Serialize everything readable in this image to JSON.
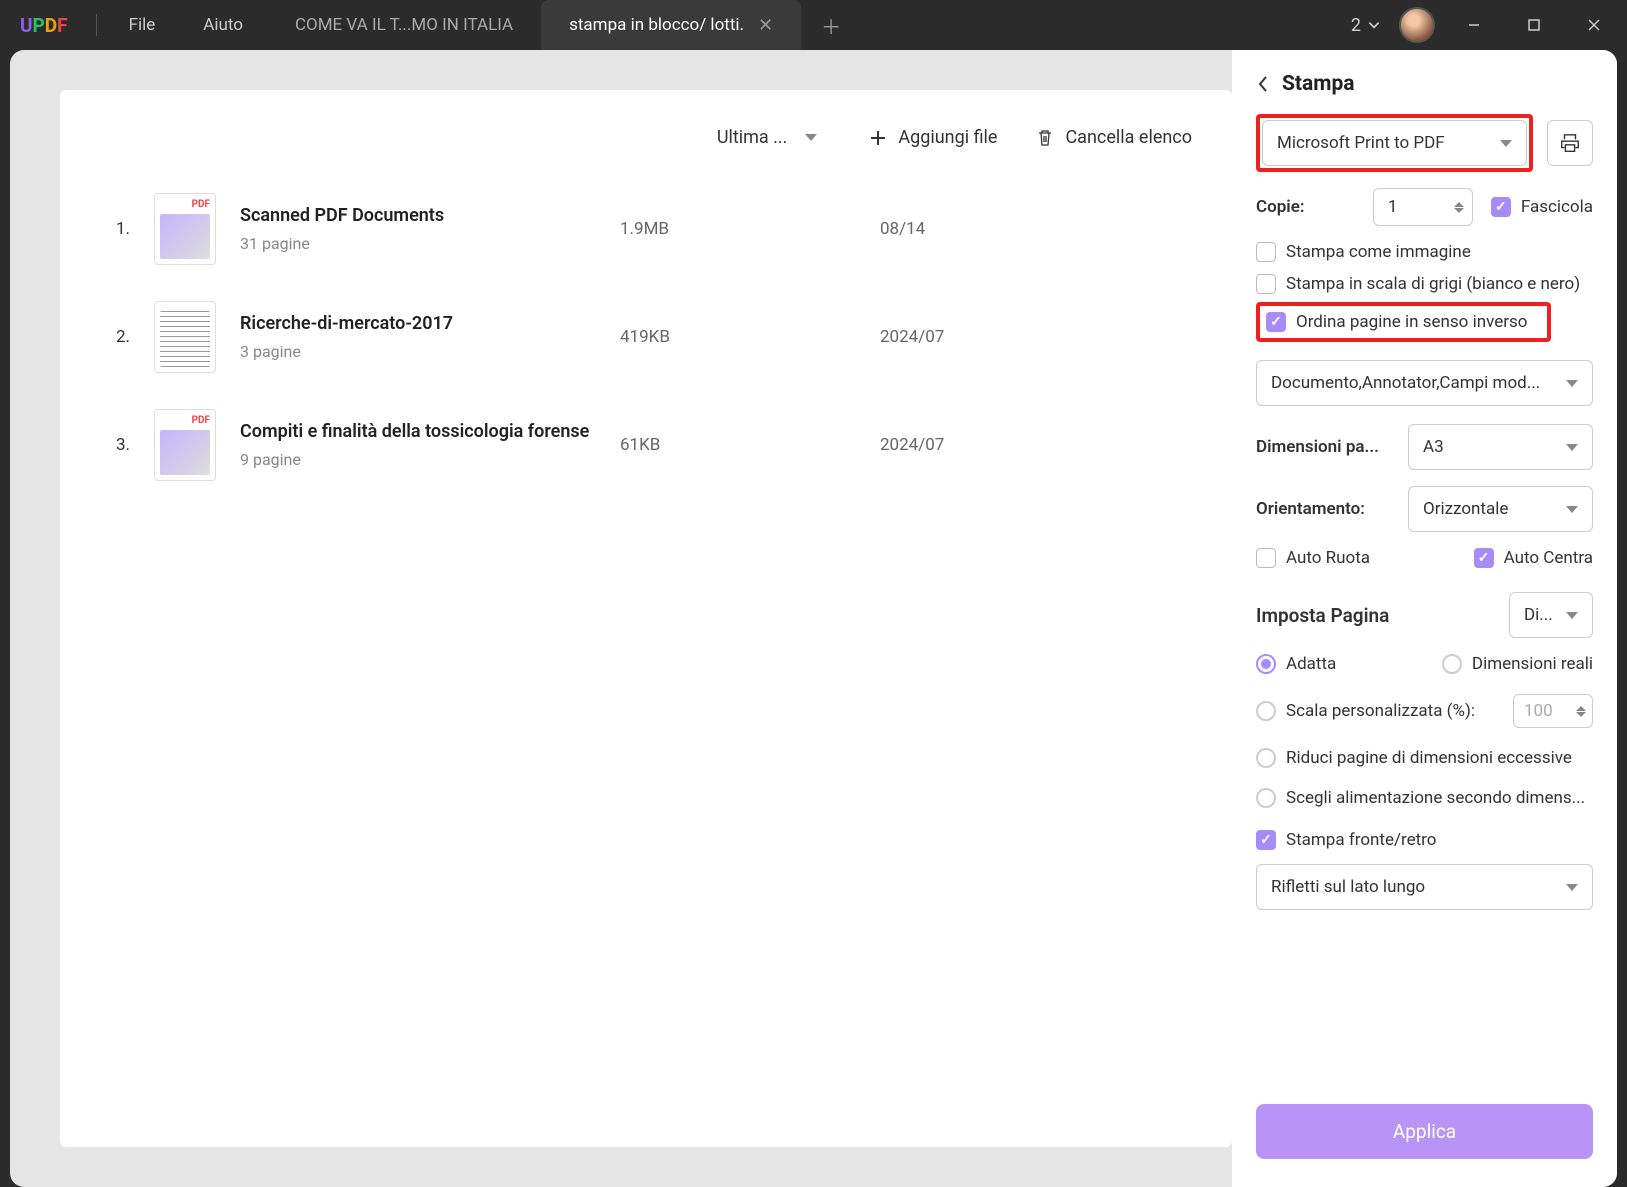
{
  "titlebar": {
    "menu_file": "File",
    "menu_help": "Aiuto",
    "tab_inactive": "COME VA IL T...MO IN ITALIA",
    "tab_active": "stampa in blocco/ lotti.",
    "counter": "2"
  },
  "toolbar": {
    "sort": "Ultima ...",
    "add_file": "Aggiungi file",
    "clear": "Cancella elenco"
  },
  "files": [
    {
      "idx": "1.",
      "name": "Scanned PDF Documents",
      "pages": "31 pagine",
      "size": "1.9MB",
      "date": "08/14",
      "thumb": "pdf"
    },
    {
      "idx": "2.",
      "name": "Ricerche-di-mercato-2017",
      "pages": "3 pagine",
      "size": "419KB",
      "date": "2024/07",
      "thumb": "doc"
    },
    {
      "idx": "3.",
      "name": "Compiti e finalità della tossicologia forense",
      "pages": "9 pagine",
      "size": "61KB",
      "date": "2024/07",
      "thumb": "pdf"
    }
  ],
  "panel": {
    "title": "Stampa",
    "printer": "Microsoft Print to PDF",
    "copies_label": "Copie:",
    "copies_value": "1",
    "collate": "Fascicola",
    "print_as_image": "Stampa come immagine",
    "grayscale": "Stampa in scala di grigi (bianco e nero)",
    "reverse": "Ordina pagine in senso inverso",
    "content_dd": "Documento,Annotator,Campi mod...",
    "paper_label": "Dimensioni pa...",
    "paper_value": "A3",
    "orient_label": "Orientamento:",
    "orient_value": "Orizzontale",
    "auto_rotate": "Auto Ruota",
    "auto_center": "Auto Centra",
    "page_setup": "Imposta Pagina",
    "page_setup_dd": "Di...",
    "radio_fit": "Adatta",
    "radio_actual": "Dimensioni reali",
    "radio_scale": "Scala personalizzata (%):",
    "scale_value": "100",
    "radio_shrink": "Riduci pagine di dimensioni eccessive",
    "radio_source": "Scegli alimentazione secondo dimens...",
    "duplex": "Stampa fronte/retro",
    "flip": "Rifletti sul lato lungo",
    "apply": "Applica"
  }
}
